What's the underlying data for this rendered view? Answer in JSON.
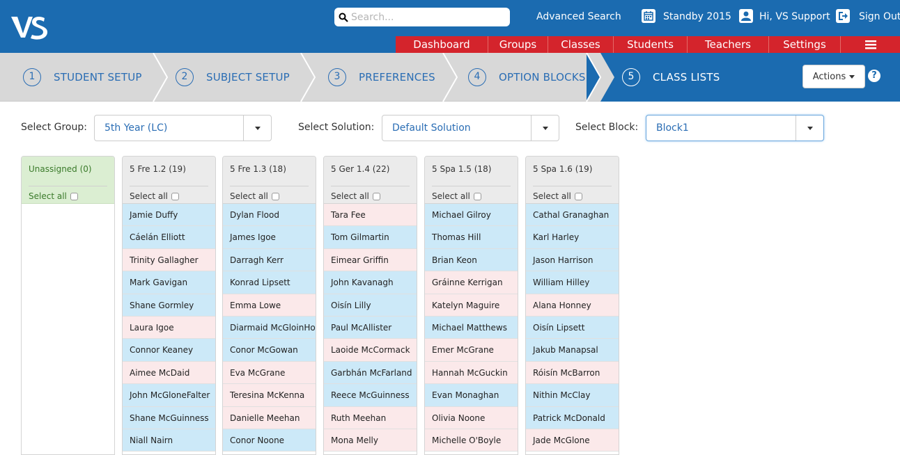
{
  "header": {
    "logo_text": "VS",
    "search_placeholder": "Search...",
    "advanced_search": "Advanced Search",
    "year": "Standby 2015",
    "greeting": "Hi, VS Support",
    "sign_out": "Sign Out",
    "nav": [
      "Dashboard",
      "Groups",
      "Classes",
      "Students",
      "Teachers",
      "Settings"
    ],
    "colors": {
      "header": "#1b6bb0",
      "menu": "#d4242c"
    }
  },
  "steps": [
    {
      "num": "1",
      "label": "STUDENT SETUP"
    },
    {
      "num": "2",
      "label": "SUBJECT SETUP"
    },
    {
      "num": "3",
      "label": "PREFERENCES"
    },
    {
      "num": "4",
      "label": "OPTION BLOCKS"
    },
    {
      "num": "5",
      "label": "CLASS LISTS"
    }
  ],
  "actions_label": "Actions",
  "filters": {
    "group_label": "Select Group:",
    "group_value": "5th Year (LC)",
    "solution_label": "Select Solution:",
    "solution_value": "Default Solution",
    "block_label": "Select Block:",
    "block_value": "Block1"
  },
  "select_all_label": "Select all",
  "unassigned": {
    "title": "Unassigned (0)"
  },
  "columns": [
    {
      "title": "5 Fre 1.2 (19)",
      "students": [
        {
          "name": "Jamie Duffy",
          "g": "m"
        },
        {
          "name": "Cáelán Elliott",
          "g": "m"
        },
        {
          "name": "Trinity Gallagher",
          "g": "f"
        },
        {
          "name": "Mark Gavigan",
          "g": "m"
        },
        {
          "name": "Shane Gormley",
          "g": "m"
        },
        {
          "name": "Laura Igoe",
          "g": "f"
        },
        {
          "name": "Connor Keaney",
          "g": "m"
        },
        {
          "name": "Aimee McDaid",
          "g": "f"
        },
        {
          "name": "John McGloneFalter",
          "g": "m"
        },
        {
          "name": "Shane McGuinness",
          "g": "m"
        },
        {
          "name": "Niall Nairn",
          "g": "m"
        }
      ]
    },
    {
      "title": "5 Fre 1.3 (18)",
      "students": [
        {
          "name": "Dylan Flood",
          "g": "m"
        },
        {
          "name": "James Igoe",
          "g": "m"
        },
        {
          "name": "Darragh Kerr",
          "g": "m"
        },
        {
          "name": "Konrad Lipsett",
          "g": "m"
        },
        {
          "name": "Emma Lowe",
          "g": "f"
        },
        {
          "name": "Diarmaid McGloinHoma",
          "g": "m"
        },
        {
          "name": "Conor McGowan",
          "g": "m"
        },
        {
          "name": "Eva McGrane",
          "g": "f"
        },
        {
          "name": "Teresina McKenna",
          "g": "f"
        },
        {
          "name": "Danielle Meehan",
          "g": "f"
        },
        {
          "name": "Conor Noone",
          "g": "m"
        }
      ]
    },
    {
      "title": "5 Ger 1.4 (22)",
      "students": [
        {
          "name": "Tara Fee",
          "g": "f"
        },
        {
          "name": "Tom Gilmartin",
          "g": "m"
        },
        {
          "name": "Eimear Griffin",
          "g": "f"
        },
        {
          "name": "John Kavanagh",
          "g": "m"
        },
        {
          "name": "Oisín Lilly",
          "g": "m"
        },
        {
          "name": "Paul McAllister",
          "g": "m"
        },
        {
          "name": "Laoide McCormack",
          "g": "f"
        },
        {
          "name": "Garbhán McFarland",
          "g": "m"
        },
        {
          "name": "Reece McGuinness",
          "g": "m"
        },
        {
          "name": "Ruth Meehan",
          "g": "f"
        },
        {
          "name": "Mona Melly",
          "g": "f"
        }
      ]
    },
    {
      "title": "5 Spa 1.5 (18)",
      "students": [
        {
          "name": "Michael Gilroy",
          "g": "m"
        },
        {
          "name": "Thomas Hill",
          "g": "m"
        },
        {
          "name": "Brian Keon",
          "g": "m"
        },
        {
          "name": "Gráinne Kerrigan",
          "g": "f"
        },
        {
          "name": "Katelyn Maguire",
          "g": "f"
        },
        {
          "name": "Michael Matthews",
          "g": "m"
        },
        {
          "name": "Emer McGrane",
          "g": "f"
        },
        {
          "name": "Hannah McGuckin",
          "g": "f"
        },
        {
          "name": "Evan Monaghan",
          "g": "m"
        },
        {
          "name": "Olivia Noone",
          "g": "f"
        },
        {
          "name": "Michelle O'Boyle",
          "g": "f"
        }
      ]
    },
    {
      "title": "5 Spa 1.6 (19)",
      "students": [
        {
          "name": "Cathal Granaghan",
          "g": "m"
        },
        {
          "name": "Karl Harley",
          "g": "m"
        },
        {
          "name": "Jason Harrison",
          "g": "m"
        },
        {
          "name": "William Hilley",
          "g": "m"
        },
        {
          "name": "Alana Honney",
          "g": "f"
        },
        {
          "name": "Oisín Lipsett",
          "g": "m"
        },
        {
          "name": "Jakub Manapsal",
          "g": "m"
        },
        {
          "name": "Róisín McBarron",
          "g": "f"
        },
        {
          "name": "Nithin McClay",
          "g": "m"
        },
        {
          "name": "Patrick McDonald",
          "g": "m"
        },
        {
          "name": "Jade McGlone",
          "g": "f"
        }
      ]
    }
  ]
}
